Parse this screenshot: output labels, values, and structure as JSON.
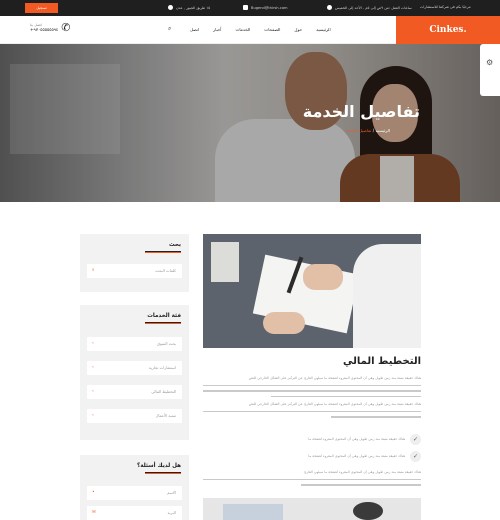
{
  "topbar": {
    "login_label": "تسجيل",
    "email": "Bugend@thirsh.com",
    "address": "١٥ طريق الجبور , عدن",
    "hours": "ساعات العمل :من ٩ص إلى ٥م - الأحد إلى الخميس",
    "promo": "مرحبًا بكم في شركتنا للاستشارات"
  },
  "header": {
    "phone_label": "اتصل بنا",
    "phone_number": "+٩٧٠٥٥٥٥٥٥٩٤",
    "nav": [
      "الرئيسية",
      "حول",
      "الصفحات",
      "الخدمات",
      "أخبار",
      "اتصل"
    ],
    "logo": "Cinkes."
  },
  "hero": {
    "title": "تفاصيل الخدمة",
    "crumb_home": "الرئيسية",
    "crumb_sep": "/",
    "crumb_current": "تفاصيل الخدمة"
  },
  "sidebar": {
    "search_title": "بحث",
    "search_placeholder": "كلمات البحث",
    "categories_title": "فئة الخدمات",
    "categories": [
      "بحث السوق",
      "استشارات تجارية",
      "التخطيط المالي",
      "تنمية الأعمال"
    ],
    "question_title": "هل لديك أسئلة؟",
    "form_fields": [
      "الاسم",
      "البريد"
    ]
  },
  "main": {
    "service_title": "التخطيط المالي",
    "paragraph": "هناك حقيقة مثبتة منذ زمن طويل وهي أن المحتوى المقروء لصفحة ما سيلهي القارئ عن التركيز على الشكل الخارجي للنص",
    "checks": [
      "هناك حقيقة مثبتة منذ زمن طويل وهي أن المحتوى المقروء لصفحة ما",
      "هناك حقيقة مثبتة منذ زمن طويل وهي أن المحتوى المقروء لصفحة ما"
    ],
    "after_checks": "هناك حقيقة مثبتة منذ زمن طويل وهي أن المحتوى المقروء لصفحة ما سيلهي القارئ"
  },
  "colors": {
    "accent": "#f15a22",
    "dark": "#1f1f1f"
  }
}
